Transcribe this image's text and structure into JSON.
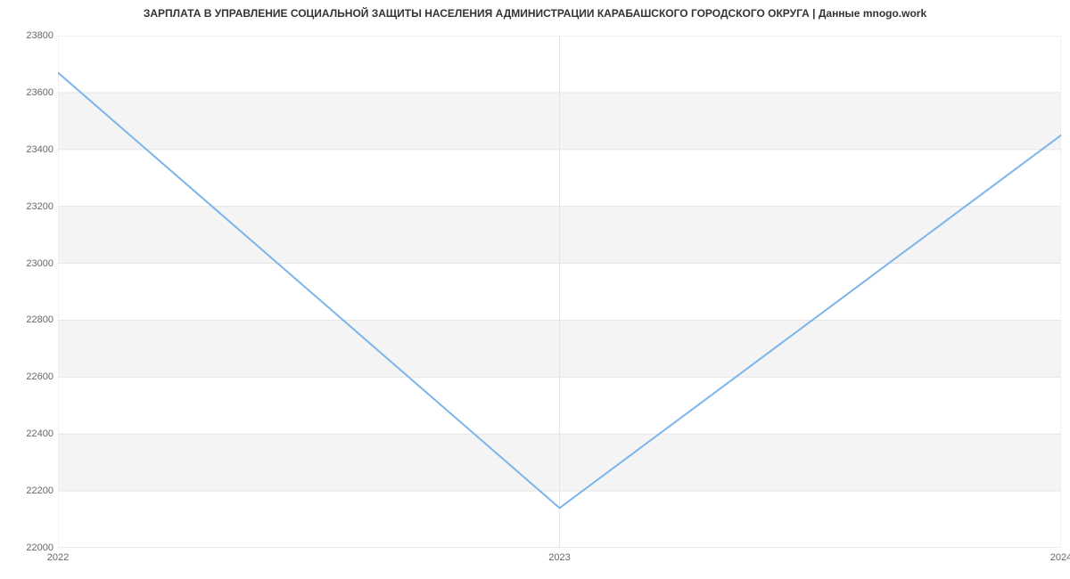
{
  "chart_data": {
    "type": "line",
    "title": "ЗАРПЛАТА В УПРАВЛЕНИЕ СОЦИАЛЬНОЙ ЗАЩИТЫ НАСЕЛЕНИЯ АДМИНИСТРАЦИИ КАРАБАШСКОГО ГОРОДСКОГО ОКРУГА | Данные mnogo.work",
    "x": [
      2022,
      2023,
      2024
    ],
    "values": [
      23670,
      22140,
      23450
    ],
    "xlabel": "",
    "ylabel": "",
    "xlim": [
      2022,
      2024
    ],
    "ylim": [
      22000,
      23800
    ],
    "y_ticks": [
      22000,
      22200,
      22400,
      22600,
      22800,
      23000,
      23200,
      23400,
      23600,
      23800
    ],
    "x_ticks": [
      2022,
      2023,
      2024
    ],
    "line_color": "#7cb5ec",
    "band_color": "#f4f4f4",
    "grid_line_color": "#e6e6e6",
    "axis_line_color": "#ccd6eb"
  }
}
